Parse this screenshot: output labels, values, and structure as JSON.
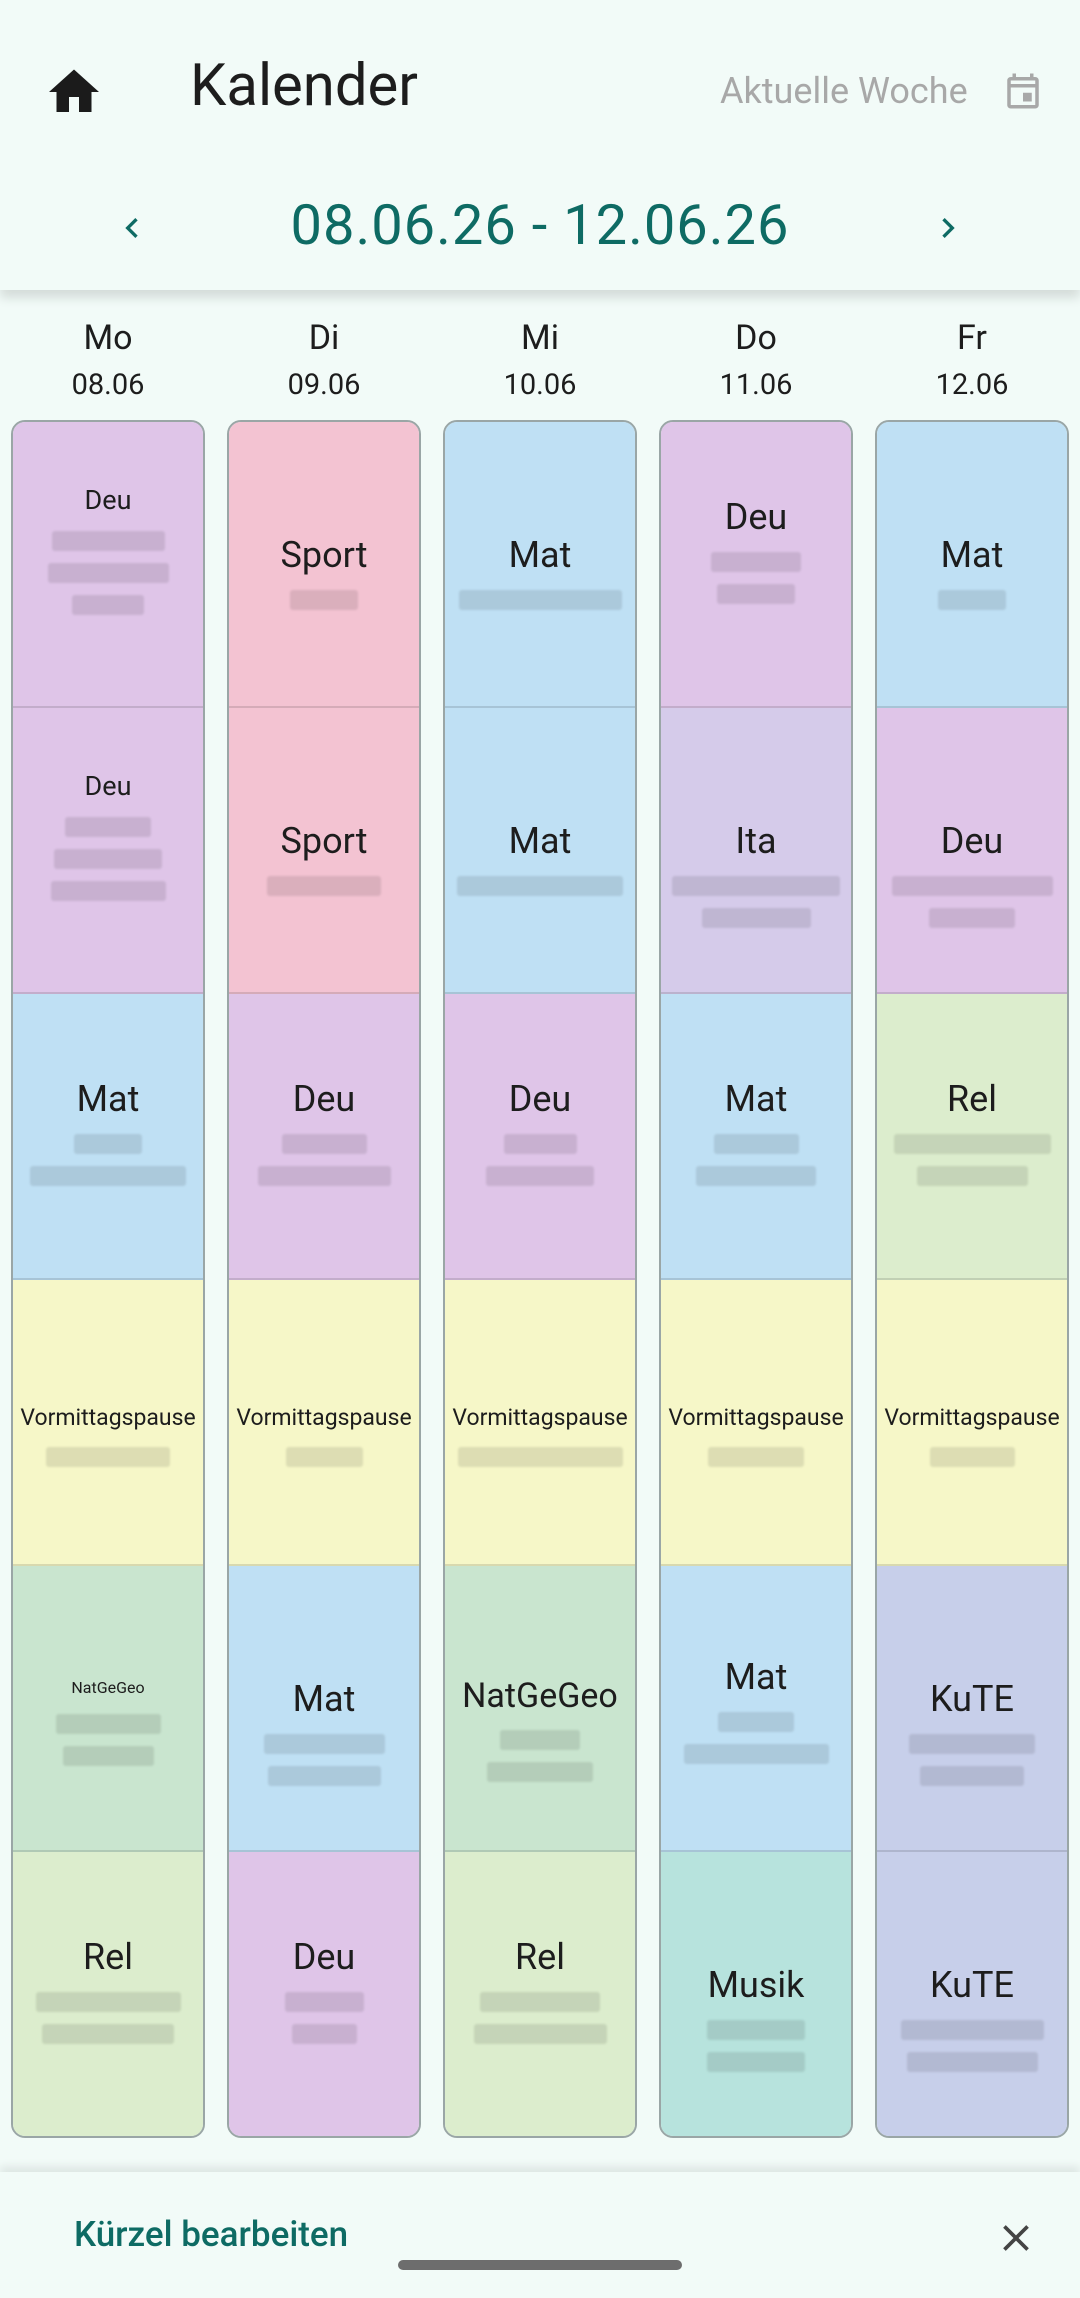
{
  "header": {
    "title": "Kalender",
    "current_week_label": "Aktuelle Woche",
    "range": "08.06.26 - 12.06.26"
  },
  "days": [
    {
      "weekday": "Mo",
      "date": "08.06"
    },
    {
      "weekday": "Di",
      "date": "09.06"
    },
    {
      "weekday": "Mi",
      "date": "10.06"
    },
    {
      "weekday": "Do",
      "date": "11.06"
    },
    {
      "weekday": "Fr",
      "date": "12.06"
    }
  ],
  "lessons": [
    [
      "Deu",
      "Deu",
      "Mat",
      "Vormittagspause",
      "NatGeGeo",
      "Rel"
    ],
    [
      "Sport",
      "Sport",
      "Deu",
      "Vormittagspause",
      "Mat",
      "Deu"
    ],
    [
      "Mat",
      "Mat",
      "Deu",
      "Vormittagspause",
      "NatGeGeo",
      "Rel"
    ],
    [
      "Deu",
      "Ita",
      "Mat",
      "Vormittagspause",
      "Mat",
      "Musik"
    ],
    [
      "Mat",
      "Deu",
      "Rel",
      "Vormittagspause",
      "KuTE",
      "KuTE"
    ]
  ],
  "colors": {
    "Deu": "#dfc5e8",
    "Sport": "#f3c3d2",
    "Mat": "#bfe0f4",
    "Ita": "#d5cbea",
    "Rel": "#dcedcd",
    "Vormittagspause": "#f6f7c8",
    "NatGeGeo": "#c9e5cf",
    "Musik": "#b7e3dd",
    "KuTE": "#c7cfea",
    "accent": "#0e6b64"
  },
  "footer": {
    "edit_label": "Kürzel bearbeiten"
  },
  "icons": {
    "home": "home-icon",
    "calendar": "calendar-icon",
    "prev": "chevron-left-icon",
    "next": "chevron-right-icon",
    "close": "close-icon"
  }
}
